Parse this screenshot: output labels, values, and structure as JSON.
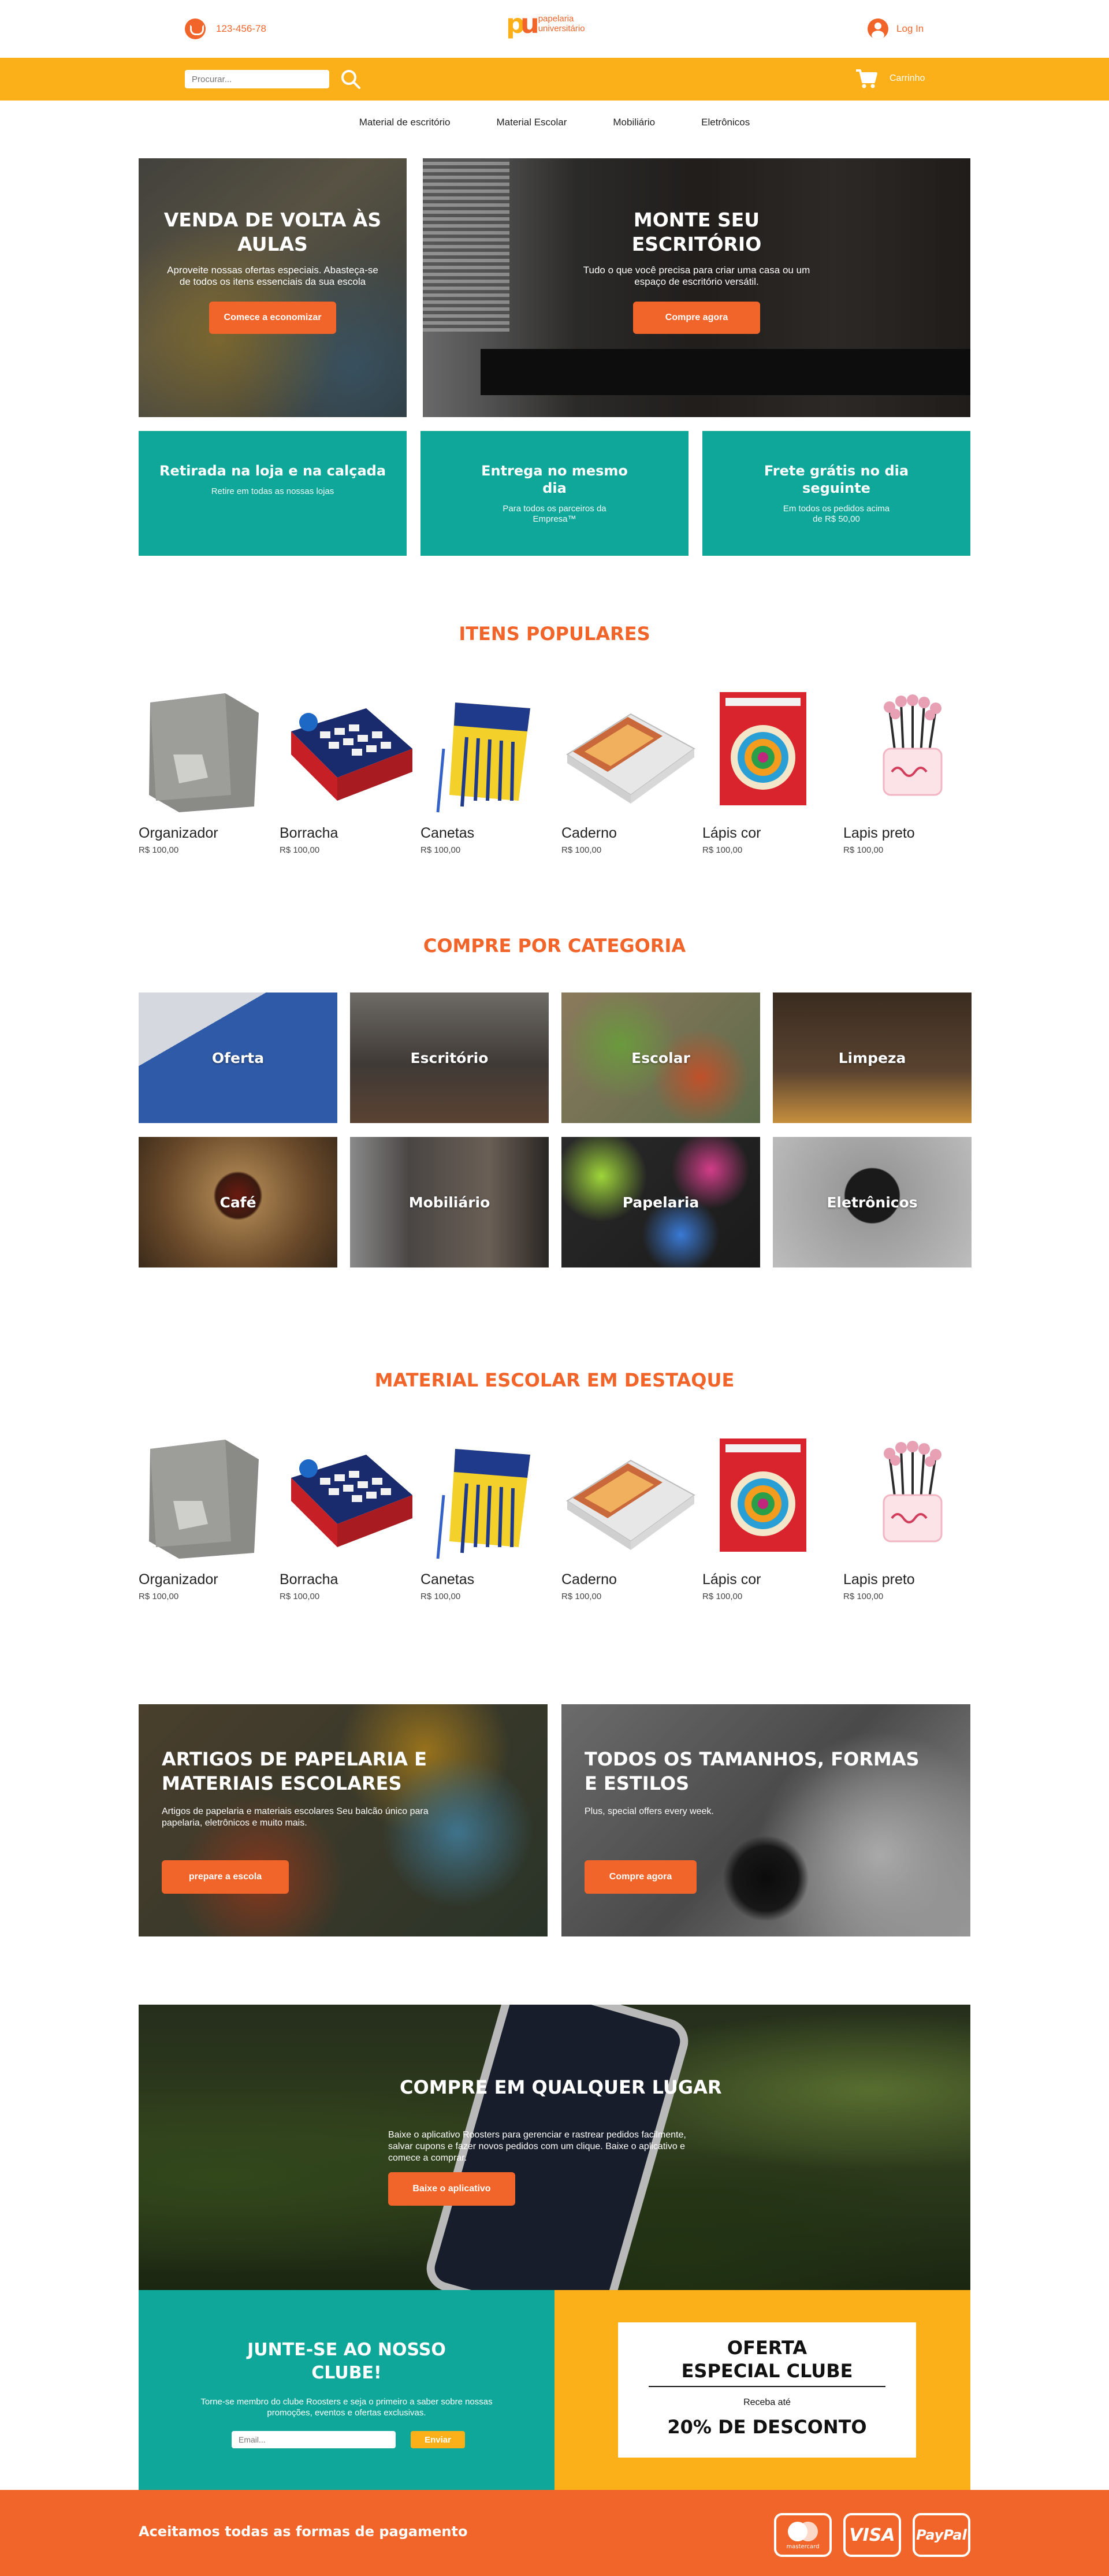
{
  "header": {
    "phone": "123-456-78",
    "logo_line1": "papelaria",
    "logo_line2": "universitário",
    "login": "Log In"
  },
  "searchbar": {
    "search_placeholder": "Procurar...",
    "cart_label": "Carrinho"
  },
  "nav": {
    "items": [
      "Material de escritório",
      "Material Escolar",
      "Mobiliário",
      "Eletrônicos"
    ]
  },
  "heroes": [
    {
      "title": "VENDA DE VOLTA ÀS AULAS",
      "text": "Aproveite nossas ofertas especiais. Abasteça-se de todos os itens essenciais da sua escola",
      "button": "Comece a economizar"
    },
    {
      "title": "MONTE SEU ESCRITÓRIO",
      "text": "Tudo o que você precisa para criar uma casa ou um espaço de escritório versátil.",
      "button": "Compre agora"
    }
  ],
  "features": [
    {
      "title": "Retirada na loja e na calçada",
      "text": "Retire em todas as nossas lojas"
    },
    {
      "title": "Entrega no mesmo dia",
      "text": "Para todos os parceiros da Empresa™"
    },
    {
      "title": "Frete grátis no dia seguinte",
      "text": "Em todos os pedidos acima de R$ 50,00"
    }
  ],
  "popular": {
    "title": "ITENS POPULARES",
    "products": [
      {
        "name": "Organizador",
        "price": "R$ 100,00"
      },
      {
        "name": "Borracha",
        "price": "R$ 100,00"
      },
      {
        "name": "Canetas",
        "price": "R$ 100,00"
      },
      {
        "name": "Caderno",
        "price": "R$ 100,00"
      },
      {
        "name": "Lápis cor",
        "price": "R$ 100,00"
      },
      {
        "name": "Lapis preto",
        "price": "R$ 100,00"
      }
    ]
  },
  "categories": {
    "title": "COMPRE POR CATEGORIA",
    "items": [
      "Oferta",
      "Escritório",
      "Escolar",
      "Limpeza",
      "Café",
      "Mobiliário",
      "Papelaria",
      "Eletrônicos"
    ]
  },
  "featured": {
    "title": "MATERIAL ESCOLAR EM DESTAQUE",
    "products": [
      {
        "name": "Organizador",
        "price": "R$ 100,00"
      },
      {
        "name": "Borracha",
        "price": "R$ 100,00"
      },
      {
        "name": "Canetas",
        "price": "R$ 100,00"
      },
      {
        "name": "Caderno",
        "price": "R$ 100,00"
      },
      {
        "name": "Lápis cor",
        "price": "R$ 100,00"
      },
      {
        "name": "Lapis preto",
        "price": "R$ 100,00"
      }
    ]
  },
  "promos": [
    {
      "title": "ARTIGOS DE PAPELARIA E MATERIAIS ESCOLARES",
      "text": "Artigos de papelaria e materiais escolares Seu balcão único para papelaria, eletrônicos e muito mais.",
      "button": "prepare a escola"
    },
    {
      "title": "TODOS OS TAMANHOS, FORMAS E ESTILOS",
      "text": "Plus, special offers every week.",
      "button": "Compre agora"
    }
  ],
  "app": {
    "title": "COMPRE EM QUALQUER LUGAR",
    "text": "Baixe o aplicativo Roosters para gerenciar e rastrear pedidos facilmente, salvar cupons e fazer novos pedidos com um clique. Baixe o aplicativo e comece a comprar.",
    "button": "Baixe o aplicativo"
  },
  "club": {
    "title": "JUNTE-SE AO NOSSO CLUBE!",
    "text": "Torne-se membro do clube Roosters e seja o primeiro a saber sobre nossas promoções, eventos e ofertas exclusivas.",
    "email_placeholder": "Email...",
    "button": "Enviar"
  },
  "offer": {
    "title": "OFERTA ESPECIAL CLUBE",
    "small": "Receba até",
    "big": "20% DE DESCONTO"
  },
  "footer": {
    "text": "Aceitamos todas as formas de pagamento",
    "mastercard_label": "mastercard",
    "visa_label": "VISA",
    "paypal_label": "PayPal"
  },
  "colors": {
    "orange": "#f2652a",
    "yellow": "#fbb019",
    "teal": "#0fa79a"
  }
}
